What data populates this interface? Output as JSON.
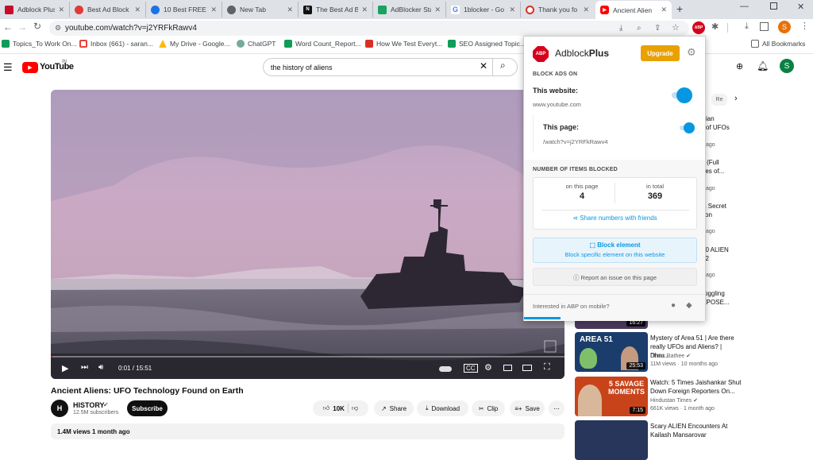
{
  "tabs": [
    {
      "title": "Adblock Plus",
      "color": "#c70d2c",
      "icon": "abp-favicon"
    },
    {
      "title": "Best Ad Block",
      "color": "#e03a3a",
      "icon": "red-circle-favicon"
    },
    {
      "title": "10 Best FREE",
      "color": "#1a73e8",
      "icon": "blue-circle-favicon"
    },
    {
      "title": "New Tab",
      "color": "#5f6368",
      "icon": "chrome-favicon"
    },
    {
      "title": "The Best Ad B",
      "color": "#111111",
      "icon": "n-favicon"
    },
    {
      "title": "AdBlocker Sta",
      "color": "#1aa260",
      "icon": "green-favicon"
    },
    {
      "title": "1blocker - Go",
      "color": "#4285f4",
      "icon": "google-favicon"
    },
    {
      "title": "Thank you fo",
      "color": "#d93025",
      "icon": "red-ring-favicon"
    },
    {
      "title": "Ancient Alien",
      "color": "#ff0000",
      "icon": "youtube-favicon"
    }
  ],
  "address": {
    "url": "youtube.com/watch?v=j2YRFkRawv4"
  },
  "bookmarks": [
    {
      "label": "Topics_To Work On...",
      "color": "#0f9d58"
    },
    {
      "label": "Inbox (661) - saran...",
      "color": "#ea4335"
    },
    {
      "label": "My Drive - Google...",
      "color": "#fbbc04"
    },
    {
      "label": "ChatGPT",
      "color": "#74aa9c"
    },
    {
      "label": "Word Count_Report...",
      "color": "#0f9d58"
    },
    {
      "label": "How We Test Everyt...",
      "color": "#d93025"
    },
    {
      "label": "SEO Assigned Topic...",
      "color": "#0f9d58"
    }
  ],
  "bookmarks_all": "All Bookmarks",
  "youtube": {
    "logo": "YouTube",
    "region": "IN",
    "search_query": "the history of aliens",
    "avatar_letter": "S",
    "time": "0:01 / 15:51",
    "video_title": "Ancient Aliens: UFO Technology Found on Earth",
    "channel": "HISTORY",
    "subscribers": "12.5M subscribers",
    "subscribe": "Subscribe",
    "likes": "10K",
    "share": "Share",
    "download": "Download",
    "clip": "Clip",
    "save": "Save",
    "views": "1.4M views  1 month ago",
    "chip_partial": "Re",
    "side_partials": [
      {
        "l1": "ian",
        "l2": "of UFOs",
        "l3": "ago"
      },
      {
        "l1": "ab (Full",
        "l2": "tures of...",
        "l3": "ago"
      },
      {
        "l1": "'s Secret",
        "l2": "tion",
        "l3": "ago"
      },
      {
        "l1": "10 ALIEN",
        "l2": "22",
        "l3": "ago"
      },
      {
        "l1": "-Boggling",
        "l2": "EXPOSE...",
        "l3": ""
      }
    ],
    "side_videos": [
      {
        "duration": "16:27"
      },
      {
        "title1": "Mystery of Area 51 | Are there",
        "title2": "really UFOs and Aliens? | Dhru...",
        "channel": "Dhruv Rathee",
        "stats": "11M views · 10 months ago",
        "duration": "25:53",
        "thumb_text": "AREA 51"
      },
      {
        "title1": "Watch: 5 Times Jaishankar Shut",
        "title2": "Down Foreign Reporters On...",
        "channel": "Hindustan Times",
        "stats": "661K views · 1 month ago",
        "duration": "7:15",
        "thumb_text": "5 SAVAGE MOMENTS"
      },
      {
        "title1": "Scary ALIEN Encounters At",
        "title2": "Kailash Mansarovar"
      }
    ]
  },
  "abp": {
    "brand_a": "Adblock",
    "brand_b": "Plus",
    "logo": "ABP",
    "upgrade": "Upgrade",
    "block_ads_on": "BLOCK ADS ON",
    "this_website": "This website:",
    "website_domain": "www.youtube.com",
    "this_page": "This page:",
    "page_path": "/watch?v=j2YRFkRawv4",
    "items_blocked": "NUMBER OF ITEMS BLOCKED",
    "on_this_page_label": "on this page",
    "on_this_page": "4",
    "in_total_label": "in total",
    "in_total": "369",
    "share_numbers": "Share numbers with friends",
    "block_element": "Block element",
    "block_element_sub": "Block specific element on this website",
    "report_issue": "Report an issue on this page",
    "mobile": "Interested in ABP on mobile?"
  },
  "colors": {
    "abp_red": "#d6001c",
    "abp_blue": "#0797e1",
    "upgrade": "#eaa100",
    "yt_red": "#ff0000"
  }
}
